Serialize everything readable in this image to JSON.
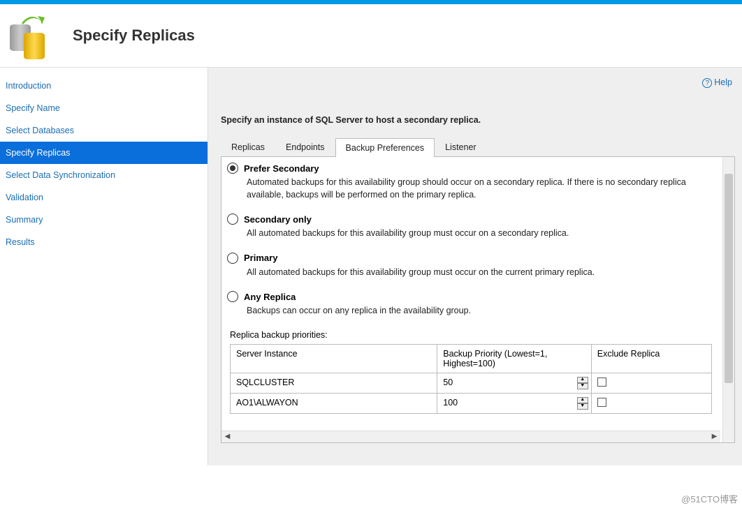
{
  "header": {
    "title": "Specify Replicas"
  },
  "help_label": "Help",
  "sidebar": {
    "items": [
      {
        "label": "Introduction"
      },
      {
        "label": "Specify Name"
      },
      {
        "label": "Select Databases"
      },
      {
        "label": "Specify Replicas",
        "active": true
      },
      {
        "label": "Select Data Synchronization"
      },
      {
        "label": "Validation"
      },
      {
        "label": "Summary"
      },
      {
        "label": "Results"
      }
    ]
  },
  "main": {
    "subheading": "Specify an instance of SQL Server to host a secondary replica.",
    "tabs": [
      {
        "label": "Replicas"
      },
      {
        "label": "Endpoints"
      },
      {
        "label": "Backup Preferences",
        "active": true
      },
      {
        "label": "Listener"
      }
    ],
    "backup_prefs": {
      "options": [
        {
          "label": "Prefer Secondary",
          "selected": true,
          "desc": "Automated backups for this availability group should occur on a secondary replica. If there is no secondary replica available, backups will be performed on the primary replica."
        },
        {
          "label": "Secondary only",
          "selected": false,
          "desc": "All automated backups for this availability group must occur on a secondary replica."
        },
        {
          "label": "Primary",
          "selected": false,
          "desc": "All automated backups for this availability group must occur on the current primary replica."
        },
        {
          "label": "Any Replica",
          "selected": false,
          "desc": "Backups can occur on any replica in the availability group."
        }
      ],
      "priorities_label": "Replica backup priorities:",
      "columns": {
        "server": "Server Instance",
        "priority": "Backup Priority (Lowest=1, Highest=100)",
        "exclude": "Exclude Replica"
      },
      "rows": [
        {
          "server": "SQLCLUSTER",
          "priority": "50",
          "exclude": false
        },
        {
          "server": "AO1\\ALWAYON",
          "priority": "100",
          "exclude": false
        }
      ]
    }
  },
  "watermark": "@51CTO博客"
}
